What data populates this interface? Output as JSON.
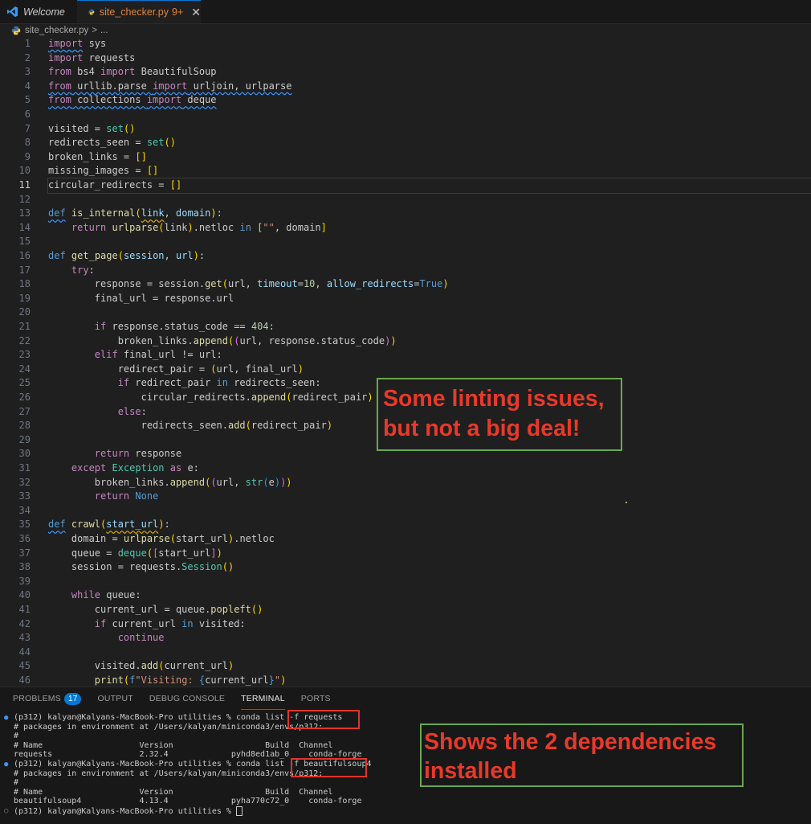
{
  "tabs": [
    {
      "label": "Welcome",
      "icon": "vscode-icon"
    },
    {
      "label": "site_checker.py",
      "badge": "9+",
      "icon": "python-icon",
      "active": true
    }
  ],
  "breadcrumb": {
    "file": "site_checker.py",
    "sep": ">",
    "rest": "..."
  },
  "editor": {
    "current_line": 11,
    "lines": [
      {
        "n": "1",
        "html": "<span class='kc sq'>import</span> sys"
      },
      {
        "n": "2",
        "html": "<span class='kc'>import</span> requests"
      },
      {
        "n": "3",
        "html": "<span class='kc'>from</span> bs4 <span class='kc'>import</span> BeautifulSoup"
      },
      {
        "n": "4",
        "html": "<span class='sq'><span class='kc'>from</span> urllib.parse <span class='kc'>import</span> urljoin, urlparse</span>"
      },
      {
        "n": "5",
        "html": "<span class='sq'><span class='kc'>from</span> collections <span class='kc'>import</span> deque</span>"
      },
      {
        "n": "6",
        "html": ""
      },
      {
        "n": "7",
        "html": "visited = <span class='c'>set</span><span class='b'>()</span>"
      },
      {
        "n": "8",
        "html": "redirects_seen = <span class='c'>set</span><span class='b'>()</span>"
      },
      {
        "n": "9",
        "html": "broken_links = <span class='b'>[]</span>"
      },
      {
        "n": "10",
        "html": "missing_images = <span class='b'>[]</span>"
      },
      {
        "n": "11",
        "html": "circular_redirects = <span class='b'>[]</span>"
      },
      {
        "n": "12",
        "html": ""
      },
      {
        "n": "13",
        "html": "<span class='k sq'>def</span> <span class='f'>is_internal</span><span class='b'>(</span><span class='p sqy'>link</span>, <span class='p'>domain</span><span class='b'>)</span>:"
      },
      {
        "n": "14",
        "html": "    <span class='kc'>return</span> <span class='f'>urlparse</span><span class='b'>(</span>link<span class='b'>)</span>.netloc <span class='k'>in</span> <span class='b'>[</span><span class='s'>\"\"</span>, domain<span class='b'>]</span>"
      },
      {
        "n": "15",
        "html": ""
      },
      {
        "n": "16",
        "html": "<span class='k'>def</span> <span class='f'>get_page</span><span class='b'>(</span><span class='p'>session</span>, <span class='p'>url</span><span class='b'>)</span>:"
      },
      {
        "n": "17",
        "html": "    <span class='kc'>try</span>:"
      },
      {
        "n": "18",
        "html": "        response = session.<span class='f'>get</span><span class='b'>(</span>url, <span class='p'>timeout</span>=<span class='n'>10</span>, <span class='p'>allow_redirects</span>=<span class='k'>True</span><span class='b'>)</span>"
      },
      {
        "n": "19",
        "html": "        final_url = response.url"
      },
      {
        "n": "20",
        "html": ""
      },
      {
        "n": "21",
        "html": "        <span class='kc'>if</span> response.status_code == <span class='n'>404</span>:"
      },
      {
        "n": "22",
        "html": "            broken_links.<span class='f'>append</span><span class='b'>(</span><span class='b2'>(</span>url, response.status_code<span class='b2'>)</span><span class='b'>)</span>"
      },
      {
        "n": "23",
        "html": "        <span class='kc'>elif</span> final_url != url:"
      },
      {
        "n": "24",
        "html": "            redirect_pair = <span class='b'>(</span>url, final_url<span class='b'>)</span>"
      },
      {
        "n": "25",
        "html": "            <span class='kc'>if</span> redirect_pair <span class='k'>in</span> redirects_seen:"
      },
      {
        "n": "26",
        "html": "                circular_redirects.<span class='f'>append</span><span class='b'>(</span>redirect_pair<span class='b'>)</span>"
      },
      {
        "n": "27",
        "html": "            <span class='kc'>else</span>:"
      },
      {
        "n": "28",
        "html": "                redirects_seen.<span class='f'>add</span><span class='b'>(</span>redirect_pair<span class='b'>)</span>"
      },
      {
        "n": "29",
        "html": ""
      },
      {
        "n": "30",
        "html": "        <span class='kc'>return</span> response"
      },
      {
        "n": "31",
        "html": "    <span class='kc'>except</span> <span class='c'>Exception</span> <span class='kc'>as</span> e:"
      },
      {
        "n": "32",
        "html": "        broken_links.<span class='f'>append</span><span class='b'>(</span><span class='b2'>(</span>url, <span class='c'>str</span><span class='b3'>(</span>e<span class='b3'>)</span><span class='b2'>)</span><span class='b'>)</span>"
      },
      {
        "n": "33",
        "html": "        <span class='kc'>return</span> <span class='k'>None</span>"
      },
      {
        "n": "34",
        "html": ""
      },
      {
        "n": "35",
        "html": "<span class='k sq'>def</span> <span class='f'>crawl</span><span class='b'>(</span><span class='p sqy'>start_url</span><span class='b'>)</span>:"
      },
      {
        "n": "36",
        "html": "    domain = <span class='f'>urlparse</span><span class='b'>(</span>start_url<span class='b'>)</span>.netloc"
      },
      {
        "n": "37",
        "html": "    queue = <span class='c'>deque</span><span class='b'>(</span><span class='b2'>[</span>start_url<span class='b2'>]</span><span class='b'>)</span>"
      },
      {
        "n": "38",
        "html": "    session = requests.<span class='c'>Session</span><span class='b'>()</span>"
      },
      {
        "n": "39",
        "html": ""
      },
      {
        "n": "40",
        "html": "    <span class='kc'>while</span> queue:"
      },
      {
        "n": "41",
        "html": "        current_url = queue.<span class='f'>popleft</span><span class='b'>()</span>"
      },
      {
        "n": "42",
        "html": "        <span class='kc'>if</span> current_url <span class='k'>in</span> visited:"
      },
      {
        "n": "43",
        "html": "            <span class='kc'>continue</span>"
      },
      {
        "n": "44",
        "html": ""
      },
      {
        "n": "45",
        "html": "        visited.<span class='f'>add</span><span class='b'>(</span>current_url<span class='b'>)</span>"
      },
      {
        "n": "46",
        "html": "        <span class='f'>print</span><span class='b'>(</span><span class='k'>f</span><span class='s'>\"Visiting: </span><span class='k'>{</span>current_url<span class='k'>}</span><span class='s'>\"</span><span class='b'>)</span>"
      }
    ]
  },
  "annotations": {
    "linting": [
      "Some linting issues,",
      "but not a big deal!"
    ],
    "deps": [
      "Shows the 2 dependencies",
      "installed"
    ]
  },
  "panel": {
    "tabs": [
      {
        "label": "PROBLEMS",
        "badge": "17"
      },
      {
        "label": "OUTPUT"
      },
      {
        "label": "DEBUG CONSOLE"
      },
      {
        "label": "TERMINAL",
        "active": true
      },
      {
        "label": "PORTS"
      }
    ],
    "terminal": [
      {
        "dot": "blue",
        "text": "(p312) kalyan@Kalyans-MacBook-Pro utilities % conda list -f requests"
      },
      {
        "dot": "",
        "text": "# packages in environment at /Users/kalyan/miniconda3/envs/p312:"
      },
      {
        "dot": "",
        "text": "#"
      },
      {
        "dot": "",
        "text": "# Name                    Version                   Build  Channel"
      },
      {
        "dot": "",
        "text": "requests                  2.32.4             pyhd8ed1ab_0    conda-forge"
      },
      {
        "dot": "blue",
        "text": "(p312) kalyan@Kalyans-MacBook-Pro utilities % conda list -f beautifulsoup4"
      },
      {
        "dot": "",
        "text": "# packages in environment at /Users/kalyan/miniconda3/envs/p312:"
      },
      {
        "dot": "",
        "text": "#"
      },
      {
        "dot": "",
        "text": "# Name                    Version                   Build  Channel"
      },
      {
        "dot": "",
        "text": "beautifulsoup4            4.13.4             pyha770c72_0    conda-forge"
      },
      {
        "dot": "hollow",
        "text": "(p312) kalyan@Kalyans-MacBook-Pro utilities % "
      }
    ]
  },
  "colors": {
    "accent": "#0078d4",
    "annotation_text": "#e8392a",
    "annotation_border": "#6aa84f",
    "highlight_box": "#e0342a"
  }
}
